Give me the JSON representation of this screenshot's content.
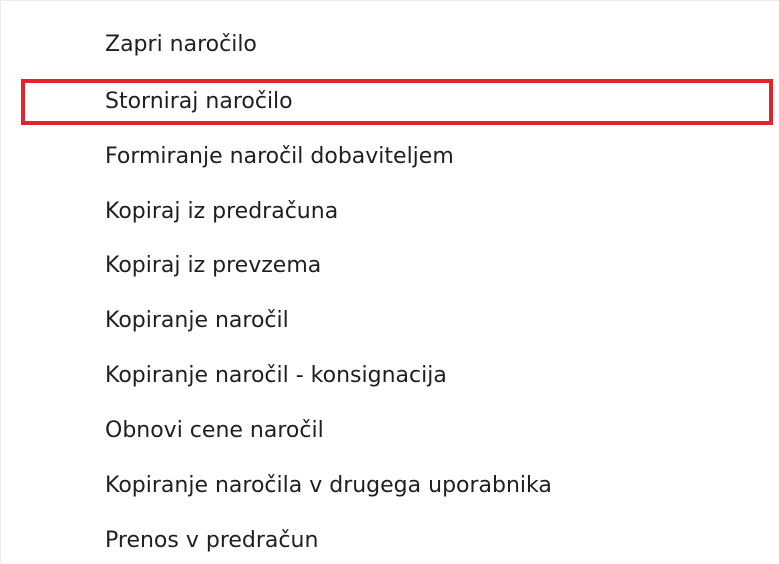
{
  "context_menu": {
    "items": [
      {
        "label": "Zapri naročilo"
      },
      {
        "label": "Storniraj naročilo"
      },
      {
        "label": "Formiranje naročil dobaviteljem"
      },
      {
        "label": "Kopiraj iz predračuna"
      },
      {
        "label": "Kopiraj iz prevzema"
      },
      {
        "label": "Kopiranje naročil"
      },
      {
        "label": "Kopiranje naročil - konsignacija"
      },
      {
        "label": "Obnovi cene naročil"
      },
      {
        "label": "Kopiranje naročila v drugega uporabnika"
      },
      {
        "label": "Prenos v predračun"
      }
    ]
  },
  "colors": {
    "highlight_border": "#e0262b",
    "text": "#1f1f1f",
    "background": "#ffffff"
  }
}
